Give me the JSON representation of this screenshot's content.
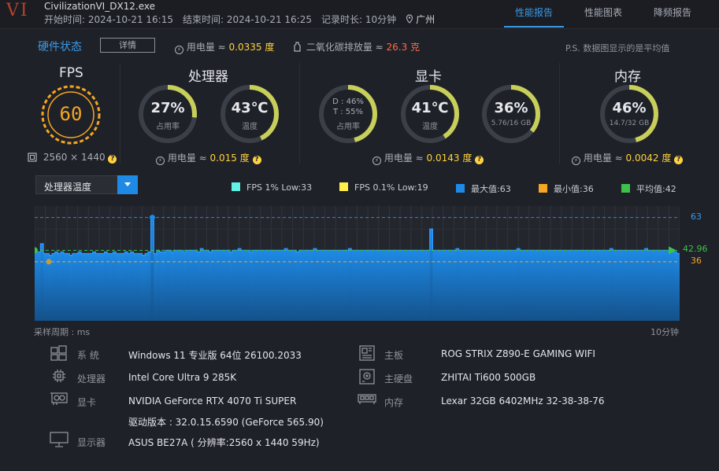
{
  "header": {
    "logo": "VI",
    "app_title": "CivilizationVI_DX12.exe",
    "start_time": "开始时间: 2024-10-21 16:15",
    "end_time": "结束时间: 2024-10-21 16:25",
    "duration": "记录时长: 10分钟",
    "location": "广州",
    "tabs": [
      "性能报告",
      "性能图表",
      "降频报告"
    ]
  },
  "status": {
    "title": "硬件状态",
    "details_label": "详情",
    "power_label": "用电量 ≈",
    "power_value": "0.0335 度",
    "co2_label": "二氧化碳排放量 ≈",
    "co2_value": "26.3 克",
    "note": "P.S. 数据图显示的是平均值"
  },
  "fps": {
    "title": "FPS",
    "value": "60",
    "resolution": "2560 × 1440"
  },
  "cpu": {
    "title": "处理器",
    "usage_value": "27%",
    "usage_label": "占用率",
    "usage_fraction": 0.27,
    "temp_value": "43℃",
    "temp_label": "温度",
    "temp_fraction": 0.43,
    "power_label": "用电量 ≈",
    "power_value": "0.015 度"
  },
  "gpu": {
    "title": "显卡",
    "d_line": "D : 46%",
    "t_line": "T : 55%",
    "usage_label": "占用率",
    "usage_fraction": 0.46,
    "temp_value": "41℃",
    "temp_label": "温度",
    "temp_fraction": 0.41,
    "vram_value": "36%",
    "vram_label": "5.76/16 GB",
    "vram_fraction": 0.36,
    "power_label": "用电量 ≈",
    "power_value": "0.0143 度"
  },
  "memory": {
    "title": "内存",
    "usage_value": "46%",
    "usage_label": "14.7/32 GB",
    "usage_fraction": 0.46,
    "power_label": "用电量 ≈",
    "power_value": "0.0042 度"
  },
  "chart_controls": {
    "selected_metric": "处理器温度",
    "legend": [
      {
        "label": "FPS 1% Low:33",
        "color": "#5ff2e6"
      },
      {
        "label": "FPS 0.1% Low:19",
        "color": "#fff04a"
      },
      {
        "label": "最大值:63",
        "color": "#1e8ae6"
      },
      {
        "label": "最小值:36",
        "color": "#f5a623"
      },
      {
        "label": "平均值:42",
        "color": "#3cc24a"
      }
    ]
  },
  "chart_data": {
    "type": "area",
    "title": "",
    "series": [
      {
        "values": [
          42,
          42,
          47,
          41,
          41,
          40,
          41,
          42,
          41,
          42,
          41,
          41,
          40,
          41,
          41,
          42,
          41,
          41,
          41,
          41,
          42,
          41,
          41,
          41,
          42,
          41,
          41,
          42,
          41,
          41,
          41,
          42,
          41,
          42,
          41,
          41,
          41,
          40,
          41,
          42,
          63,
          41,
          43,
          42,
          42,
          43,
          43,
          42,
          43,
          43,
          43,
          42,
          43,
          43,
          43,
          43,
          42,
          44,
          43,
          43,
          42,
          43,
          43,
          43,
          43,
          43,
          43,
          42,
          43,
          43,
          44,
          43,
          43,
          43,
          42,
          43,
          43,
          43,
          43,
          43,
          43,
          43,
          43,
          43,
          43,
          43,
          44,
          43,
          43,
          43,
          42,
          43,
          43,
          43,
          43,
          43,
          44,
          43,
          43,
          43,
          43,
          43,
          43,
          43,
          43,
          43,
          43,
          43,
          44,
          43,
          43,
          43,
          43,
          43,
          43,
          43,
          43,
          43,
          43,
          43,
          43,
          43,
          43,
          43,
          43,
          43,
          43,
          43,
          43,
          43,
          43,
          43,
          43,
          43,
          43,
          43,
          56,
          43,
          43,
          43,
          43,
          43,
          43,
          43,
          43,
          44,
          43,
          43,
          43,
          43,
          43,
          43,
          43,
          43,
          43,
          43,
          43,
          43,
          43,
          43,
          43,
          43,
          43,
          43,
          43,
          43,
          44,
          43,
          43,
          43,
          43,
          43,
          43,
          43,
          43,
          43,
          43,
          43,
          43,
          43,
          43,
          43,
          43,
          43,
          43,
          43,
          43,
          43,
          43,
          43,
          43,
          43,
          43,
          43,
          43,
          43,
          43,
          43,
          44,
          43,
          43,
          43,
          43,
          43,
          43,
          43,
          43,
          43,
          43,
          43,
          44,
          43,
          43,
          43,
          43,
          43,
          43,
          43,
          43,
          43,
          42,
          41
        ]
      }
    ],
    "max": 63,
    "min": 36,
    "avg": 42.96,
    "ref_labels": {
      "max": "63",
      "avg": "42.96",
      "min": "36"
    },
    "ylim": [
      0,
      70
    ],
    "xlabel_left": "采样周期 : ms",
    "xlabel_right": "10分钟"
  },
  "system_info": {
    "os_label": "系  统",
    "os_value": "Windows 11 专业版 64位 26100.2033",
    "cpu_label": "处理器",
    "cpu_value": "Intel Core Ultra 9 285K",
    "gpu_label": "显卡",
    "gpu_value": "NVIDIA GeForce RTX 4070 Ti SUPER",
    "driver_value": "驱动版本 : 32.0.15.6590 (GeForce 565.90)",
    "monitor_label": "显示器",
    "monitor_value": "ASUS BE27A ( 分辨率:2560 x 1440 59Hz)",
    "board_label": "主板",
    "board_value": "ROG STRIX Z890-E GAMING WIFI",
    "disk_label": "主硬盘",
    "disk_value": "ZHITAI Ti600 500GB",
    "mem_label": "内存",
    "mem_value": "Lexar 32GB 6402MHz 32-38-38-76"
  }
}
